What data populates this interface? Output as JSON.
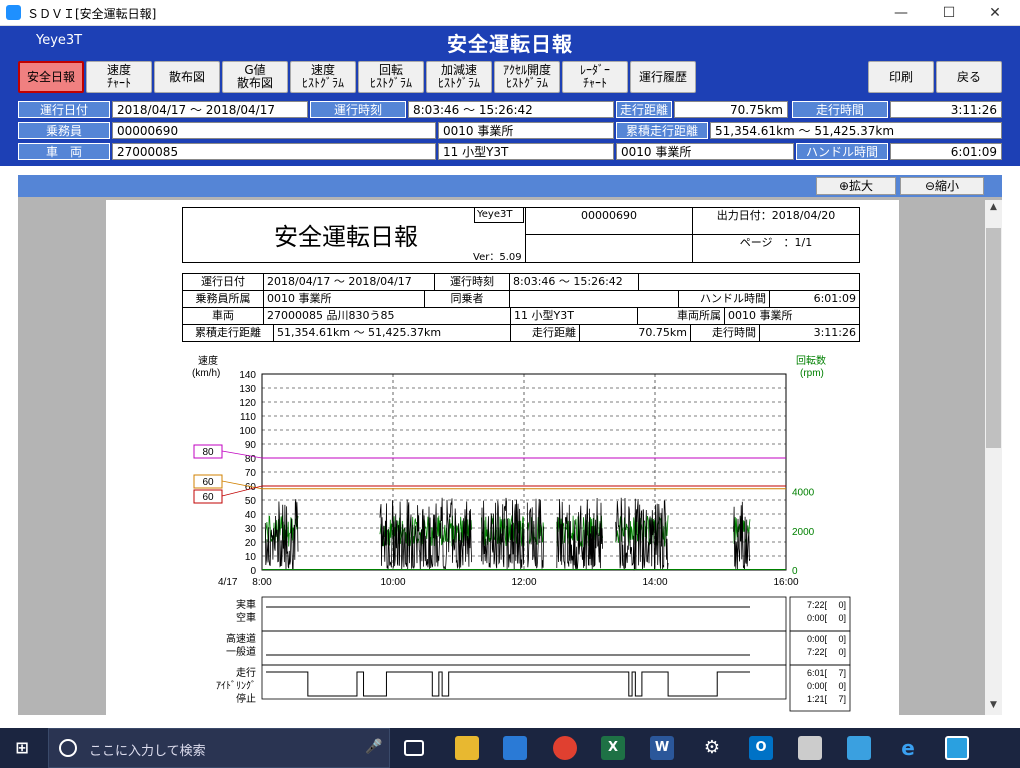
{
  "window": {
    "title": "ＳＤＶＩ[安全運転日報]",
    "min": "—",
    "max": "☐",
    "close": "✕"
  },
  "header": {
    "user": "Yeye3T",
    "title": "安全運転日報"
  },
  "toolbar": {
    "buttons": [
      {
        "l1": "安全日報",
        "l2": ""
      },
      {
        "l1": "速度",
        "l2": "ﾁｬｰﾄ"
      },
      {
        "l1": "散布図",
        "l2": ""
      },
      {
        "l1": "G値",
        "l2": "散布図"
      },
      {
        "l1": "速度",
        "l2": "ﾋｽﾄｸﾞﾗﾑ"
      },
      {
        "l1": "回転",
        "l2": "ﾋｽﾄｸﾞﾗﾑ"
      },
      {
        "l1": "加減速",
        "l2": "ﾋｽﾄｸﾞﾗﾑ"
      },
      {
        "l1": "ｱｸｾﾙ開度",
        "l2": "ﾋｽﾄｸﾞﾗﾑ"
      },
      {
        "l1": "ﾚｰﾀﾞｰ",
        "l2": "ﾁｬｰﾄ"
      },
      {
        "l1": "運行履歴",
        "l2": ""
      }
    ],
    "print": "印刷",
    "back": "戻る"
  },
  "info": {
    "date_label": "運行日付",
    "date_value": "2018/04/17 ～ 2018/04/17",
    "time_label": "運行時刻",
    "time_value": "8:03:46 ～ 15:26:42",
    "dist_label": "走行距離",
    "dist_value": "70.75km",
    "drive_label": "走行時間",
    "drive_value": "3:11:26",
    "crew_label": "乗務員",
    "crew_value": "00000690",
    "crew_office": "0010 事業所",
    "odo_label": "累積走行距離",
    "odo_value": "51,354.61km ～ 51,425.37km",
    "vehicle_label": "車　両",
    "vehicle_value": "27000085",
    "vehicle_type": "11 小型Y3T",
    "vehicle_office": "0010 事業所",
    "handle_label": "ハンドル時間",
    "handle_value": "6:01:09"
  },
  "zoom": {
    "in": "拡大",
    "out": "縮小"
  },
  "report": {
    "title": "安全運転日報",
    "user": "Yeye3T",
    "version": "Ver：5.09",
    "crew_id": "00000690",
    "output_date": "出力日付：2018/04/20",
    "page": "ページ　：1/1",
    "date_label": "運行日付",
    "date_value": "2018/04/17 ～ 2018/04/17",
    "time_label": "運行時刻",
    "time_value": "8:03:46 ～ 15:26:42",
    "crew_office_label": "乗務員所属",
    "crew_office_value": "0010 事業所",
    "codriver_label": "同乗者",
    "handle_label": "ハンドル時間",
    "handle_value": "6:01:09",
    "vehicle_label": "車両",
    "vehicle_value": "27000085 品川830う85",
    "vehicle_type": "11 小型Y3T",
    "vehicle_office_label": "車両所属",
    "vehicle_office_value": "0010 事業所",
    "odo_label": "累積走行距離",
    "odo_value": "51,354.61km ～ 51,425.37km",
    "dist_label": "走行距離",
    "dist_value": "70.75km",
    "drive_label": "走行時間",
    "drive_value": "3:11:26"
  },
  "chart_data": {
    "type": "line",
    "ylabel_left": "速度\n(km/h)",
    "ylabel_right": "回転数\n(rpm)",
    "date_label": "4/17",
    "x_ticks": [
      "8:00",
      "10:00",
      "12:00",
      "14:00",
      "16:00"
    ],
    "y_ticks": [
      0,
      10,
      20,
      30,
      40,
      50,
      60,
      70,
      80,
      90,
      100,
      110,
      120,
      130,
      140
    ],
    "y2_ticks": [
      0,
      2000,
      4000
    ],
    "ylim": [
      0,
      140
    ],
    "y2lim": [
      0,
      10000
    ],
    "limit_lines": [
      {
        "value": 80,
        "color": "#c000c0",
        "marker": "80"
      },
      {
        "value": 58,
        "color": "#d08000",
        "marker": "60"
      },
      {
        "value": 60,
        "color": "#c00000",
        "marker": "60"
      }
    ],
    "speed_color": "#000000",
    "rpm_color": "#008000",
    "activity_hours": [
      [
        8.05,
        8.55
      ],
      [
        9.8,
        11.2
      ],
      [
        11.35,
        12.0
      ],
      [
        12.05,
        12.3
      ],
      [
        12.5,
        13.2
      ],
      [
        13.4,
        14.2
      ],
      [
        15.2,
        15.45
      ]
    ]
  },
  "status": {
    "rows": [
      {
        "l1": "実車",
        "l2": "空車",
        "v1": "7:22[　 0]",
        "v2": "0:00[　 0]"
      },
      {
        "l1": "高速道",
        "l2": "一般道",
        "v1": "0:00[　 0]",
        "v2": "7:22[　 0]"
      },
      {
        "l1": "走行",
        "l2": "ｱｲﾄﾞﾘﾝｸﾞ",
        "l3": "停止",
        "v1": "6:01[　 7]",
        "v2": "0:00[　 0]",
        "v3": "1:21[　 7]"
      }
    ]
  },
  "taskbar": {
    "search_placeholder": "ここに入力して検索"
  }
}
